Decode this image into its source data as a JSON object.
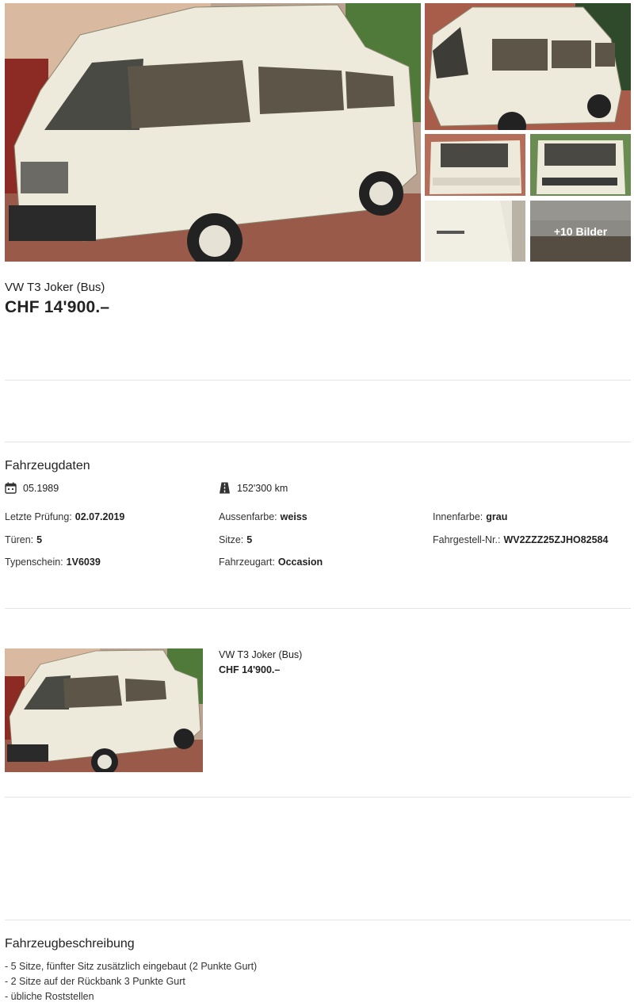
{
  "gallery": {
    "more_label": "+10 Bilder"
  },
  "listing": {
    "title": "VW T3 Joker (Bus)",
    "price": "CHF 14'900.–"
  },
  "vehicle_data": {
    "heading": "Fahrzeugdaten",
    "first_registration": "05.1989",
    "mileage": "152'300 km",
    "attributes": [
      {
        "label": "Letzte Prüfung:",
        "value": "02.07.2019"
      },
      {
        "label": "Aussenfarbe:",
        "value": "weiss"
      },
      {
        "label": "Innenfarbe:",
        "value": "grau"
      },
      {
        "label": "Türen:",
        "value": "5"
      },
      {
        "label": "Sitze:",
        "value": "5"
      },
      {
        "label": "Fahrgestell-Nr.:",
        "value": "WV2ZZZ25ZJHO82584"
      },
      {
        "label": "Typenschein:",
        "value": "1V6039"
      },
      {
        "label": "Fahrzeugart:",
        "value": "Occasion"
      }
    ]
  },
  "related": {
    "title": "VW T3 Joker (Bus)",
    "price": "CHF 14'900.–"
  },
  "description": {
    "heading": "Fahrzeugbeschreibung",
    "lines": [
      "- 5 Sitze, fünfter Sitz zusätzlich eingebaut (2 Punkte Gurt)",
      "- 2 Sitze auf der Rückbank 3 Punkte Gurt",
      "- übliche Roststellen"
    ]
  }
}
